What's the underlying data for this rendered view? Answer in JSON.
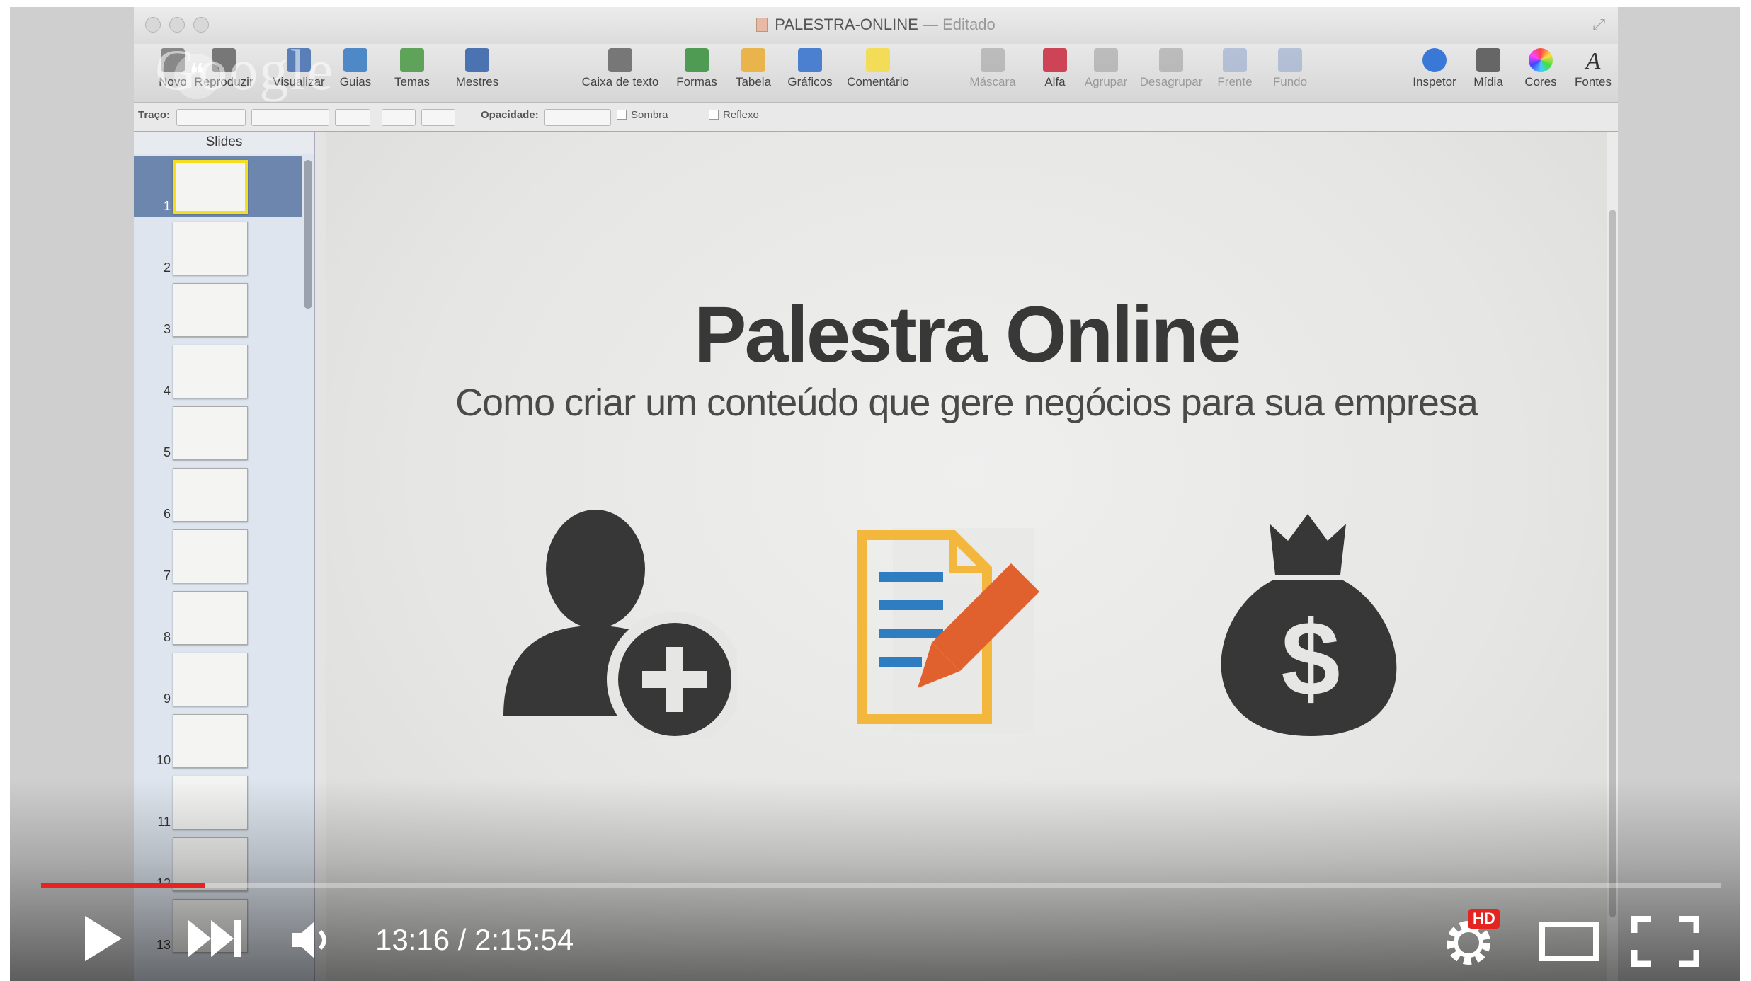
{
  "window": {
    "title": "PALESTRA-ONLINE",
    "title_separator": "—",
    "status": "Editado"
  },
  "toolbar": {
    "items": [
      {
        "label": "Novo",
        "icon": "new-slide-icon"
      },
      {
        "label": "Reproduzir",
        "icon": "play-icon"
      },
      {
        "label": "Visualizar",
        "icon": "view-icon"
      },
      {
        "label": "Guias",
        "icon": "guides-icon"
      },
      {
        "label": "Temas",
        "icon": "themes-icon"
      },
      {
        "label": "Mestres",
        "icon": "masters-icon"
      },
      {
        "label": "Caixa de texto",
        "icon": "text-box-icon"
      },
      {
        "label": "Formas",
        "icon": "shapes-icon"
      },
      {
        "label": "Tabela",
        "icon": "table-icon"
      },
      {
        "label": "Gráficos",
        "icon": "chart-icon"
      },
      {
        "label": "Comentário",
        "icon": "comment-icon"
      },
      {
        "label": "Máscara",
        "icon": "mask-icon"
      },
      {
        "label": "Alfa",
        "icon": "alpha-icon"
      },
      {
        "label": "Agrupar",
        "icon": "group-icon"
      },
      {
        "label": "Desagrupar",
        "icon": "ungroup-icon"
      },
      {
        "label": "Frente",
        "icon": "front-icon"
      },
      {
        "label": "Fundo",
        "icon": "back-icon"
      },
      {
        "label": "Inspetor",
        "icon": "inspector-icon"
      },
      {
        "label": "Mídia",
        "icon": "media-icon"
      },
      {
        "label": "Cores",
        "icon": "colors-icon"
      },
      {
        "label": "Fontes",
        "icon": "fonts-icon"
      }
    ]
  },
  "format_bar": {
    "stroke_label": "Traço:",
    "opacity_label": "Opacidade:",
    "shadow_label": "Sombra",
    "reflection_label": "Reflexo"
  },
  "sidebar": {
    "header": "Slides",
    "slides": [
      "1",
      "2",
      "3",
      "4",
      "5",
      "6",
      "7",
      "8",
      "9",
      "10",
      "11",
      "12",
      "13"
    ],
    "selected": "1"
  },
  "slide": {
    "title": "Palestra Online",
    "subtitle": "Como criar um conteúdo que gere negócios para sua empresa",
    "icons": [
      "add-user-icon",
      "document-edit-icon",
      "money-bag-icon"
    ]
  },
  "overlay": {
    "watermark": "Google"
  },
  "player": {
    "current_time": "13:16",
    "duration": "2:15:54",
    "time_display": "13:16 / 2:15:54",
    "progress_fraction": 0.0976,
    "hd_badge": "HD",
    "zoom": "100%",
    "colors": {
      "progress": "#e52421",
      "hd_badge": "#e52421"
    }
  }
}
